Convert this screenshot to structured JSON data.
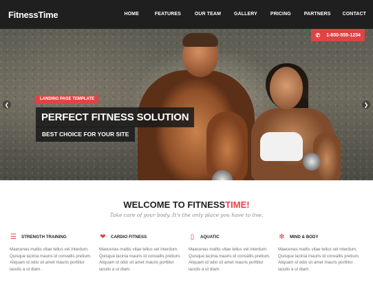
{
  "brand": {
    "logo": "FitnessTime"
  },
  "nav": {
    "items": [
      {
        "label": "HOME"
      },
      {
        "label": "FEATURES"
      },
      {
        "label": "OUR TEAM"
      },
      {
        "label": "GALLERY"
      },
      {
        "label": "PRICING"
      },
      {
        "label": "PARTNERS"
      },
      {
        "label": "CONTACT"
      }
    ]
  },
  "hero": {
    "phone": "1-800-555-1234",
    "tag": "LANDING PAGE TEMPLATE",
    "headline": "PERFECT FITNESS SOLUTION",
    "subline": "BEST CHOICE FOR YOUR SITE",
    "prev_icon": "chevron-left-icon",
    "next_icon": "chevron-right-icon"
  },
  "welcome": {
    "title_main": "WELCOME TO FITNESS",
    "title_accent": "TIME!",
    "tagline": "Take care of your body. It's the only place you have to live."
  },
  "features": [
    {
      "icon": "dumbbell-icon",
      "title": "STRENGTH TRAINING",
      "text": "Maecenas mattis vitae tellus vel interdum. Quisque lacinia mauris id convallis pretium. Aliquam id odio sit amet mauris porttitor iaculis a ut diam."
    },
    {
      "icon": "heart-pulse-icon",
      "title": "CARDIO FITNESS",
      "text": "Maecenas mattis vitae tellus vel interdum. Quisque lacinia mauris id convallis pretium. Aliquam id odio sit amet mauris porttitor iaculis a ut diam."
    },
    {
      "icon": "water-bottle-icon",
      "title": "AQUATIC",
      "text": "Maecenas mattis vitae tellus vel interdum. Quisque lacinia mauris id convallis pretium. Aliquam id odio sit amet mauris porttitor iaculis a ut diam."
    },
    {
      "icon": "mind-body-icon",
      "title": "MIND & BODY",
      "text": "Maecenas mattis vitae tellus vel interdum. Quisque lacinia mauris id convallis pretium. Aliquam id odio sit amet mauris porttitor iaculis a ut diam."
    }
  ],
  "colors": {
    "accent": "#e04343",
    "header_bg": "#1f1f1f",
    "text_dark": "#1d1d1d",
    "text_muted": "#707070"
  }
}
